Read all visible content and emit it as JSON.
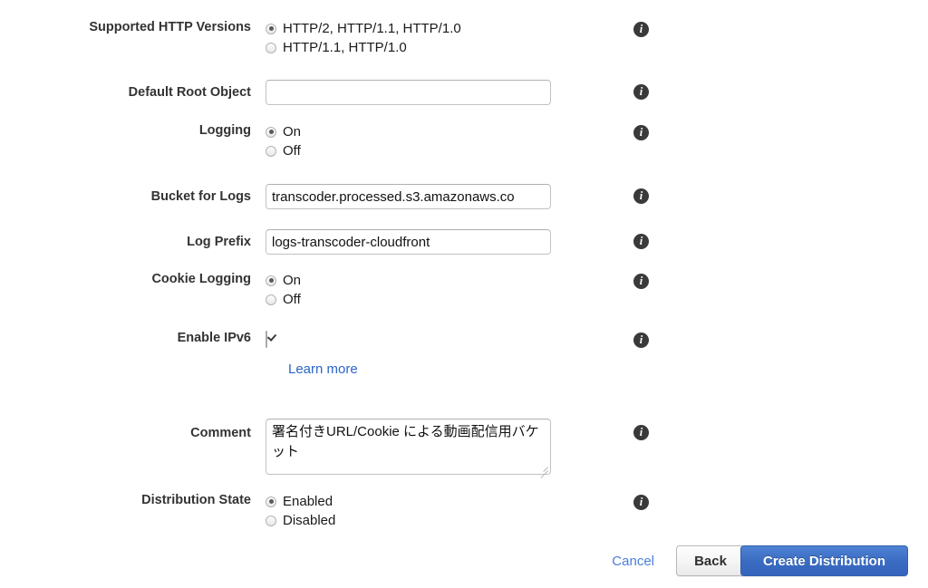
{
  "form": {
    "rows": [
      {
        "label": "Supported HTTP Versions",
        "type": "radio",
        "options": [
          {
            "text": "HTTP/2, HTTP/1.1, HTTP/1.0",
            "selected": true
          },
          {
            "text": "HTTP/1.1, HTTP/1.0",
            "selected": false
          }
        ]
      },
      {
        "label": "Default Root Object",
        "type": "text",
        "value": "",
        "placeholder": ""
      },
      {
        "label": "Logging",
        "type": "radio",
        "options": [
          {
            "text": "On",
            "selected": true
          },
          {
            "text": "Off",
            "selected": false
          }
        ]
      },
      {
        "label": "Bucket for Logs",
        "type": "text",
        "value": "transcoder.processed.s3.amazonaws.co",
        "placeholder": ""
      },
      {
        "label": "Log Prefix",
        "type": "text",
        "value": "logs-transcoder-cloudfront",
        "placeholder": ""
      },
      {
        "label": "Cookie Logging",
        "type": "radio",
        "options": [
          {
            "text": "On",
            "selected": true
          },
          {
            "text": "Off",
            "selected": false
          }
        ]
      },
      {
        "label": "Enable IPv6",
        "type": "checkbox",
        "checked": true
      },
      {
        "label": "Comment",
        "type": "textarea",
        "value": "署名付きURL/Cookie による動画配信用バケット"
      },
      {
        "label": "Distribution State",
        "type": "radio",
        "options": [
          {
            "text": "Enabled",
            "selected": true
          },
          {
            "text": "Disabled",
            "selected": false
          }
        ]
      }
    ],
    "learn_more_label": "Learn more",
    "info_icon_glyph": "i",
    "info_icon_name": "info-icon"
  },
  "footer": {
    "cancel_label": "Cancel",
    "back_label": "Back",
    "create_label": "Create Distribution"
  },
  "colors": {
    "primary_button": "#3a6cc2",
    "link": "#2a66c8",
    "cancel_link": "#4a7fd8",
    "label_text": "#333333",
    "info_icon": "#3a3a3a"
  }
}
